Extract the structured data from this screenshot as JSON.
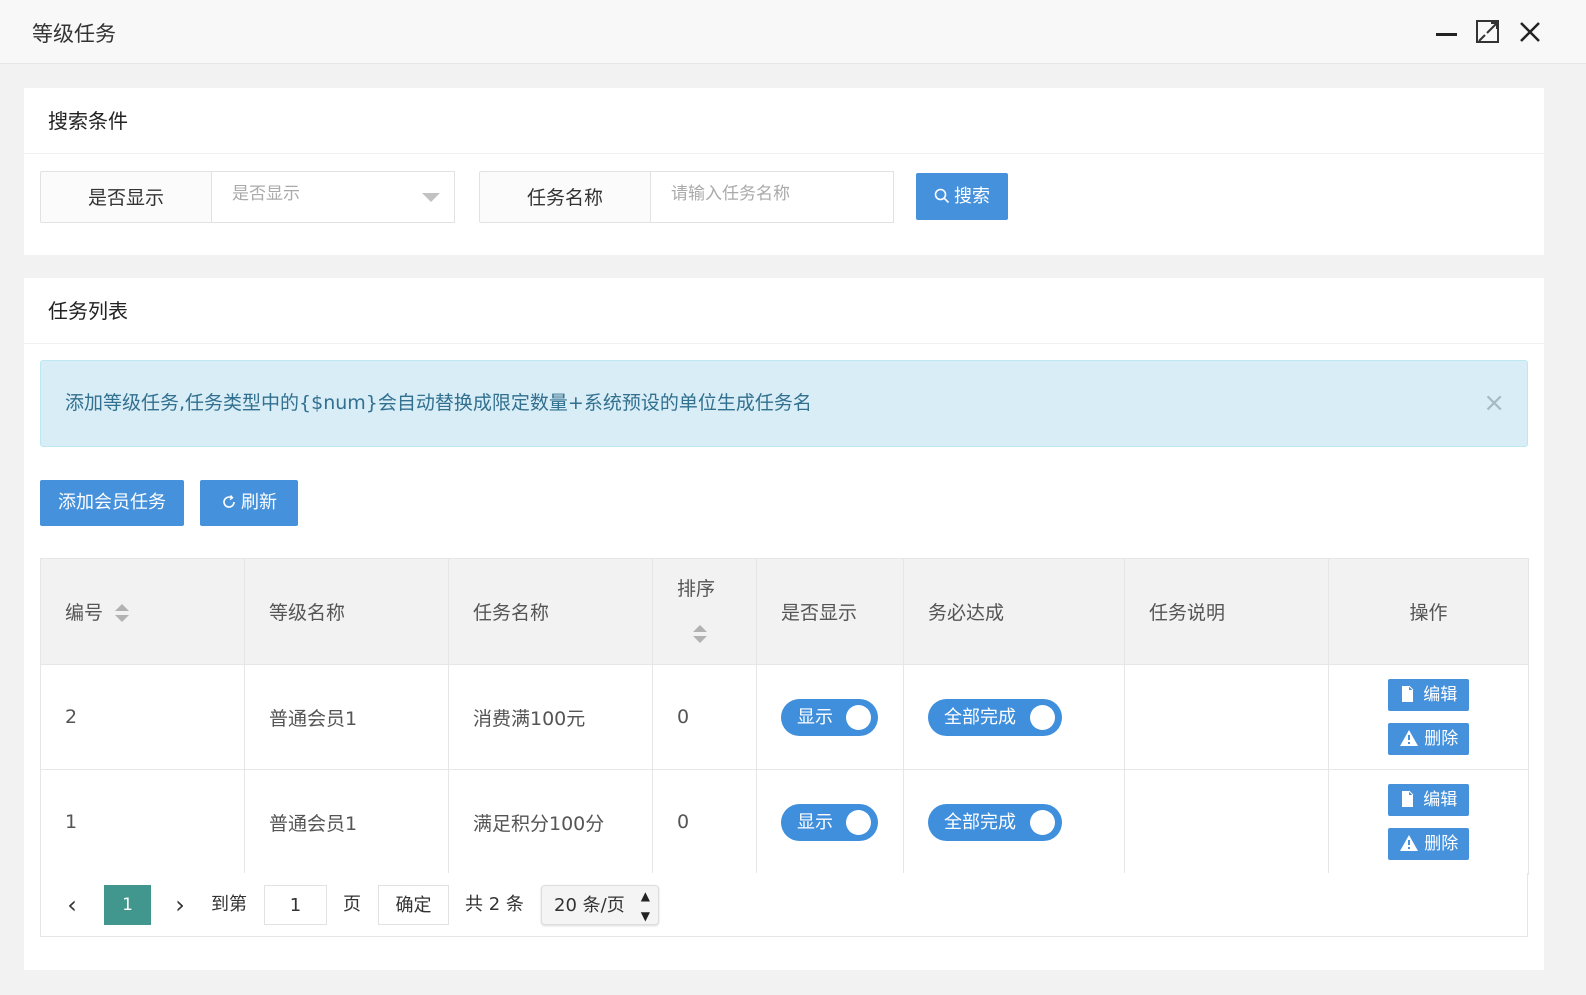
{
  "window": {
    "title": "等级任务"
  },
  "search": {
    "header": "搜索条件",
    "show_label": "是否显示",
    "show_placeholder": "是否显示",
    "name_label": "任务名称",
    "name_placeholder": "请输入任务名称",
    "search_button": "搜索"
  },
  "list": {
    "header": "任务列表",
    "alert_text": "添加等级任务,任务类型中的{$num}会自动替换成限定数量+系统预设的单位生成任务名",
    "alert_close": "×",
    "add_button": "添加会员任务",
    "refresh_button": "刷新",
    "columns": [
      "编号",
      "等级名称",
      "任务名称",
      "排序",
      "是否显示",
      "务必达成",
      "任务说明",
      "操作"
    ],
    "rows": [
      {
        "id": "2",
        "level": "普通会员1",
        "task": "消费满100元",
        "sort": "0",
        "show": "显示",
        "must": "全部完成",
        "desc": "",
        "edit": "编辑",
        "delete": "删除"
      },
      {
        "id": "1",
        "level": "普通会员1",
        "task": "满足积分100分",
        "sort": "0",
        "show": "显示",
        "must": "全部完成",
        "desc": "",
        "edit": "编辑",
        "delete": "删除"
      }
    ]
  },
  "pager": {
    "prev": "‹",
    "current": "1",
    "next": "›",
    "goto_label": "到第",
    "goto_value": "1",
    "page_unit": "页",
    "confirm": "确定",
    "total": "共 2 条",
    "page_size": "20 条/页"
  },
  "colors": {
    "primary": "#4691dc",
    "pager_active": "#41968d",
    "alert_bg": "#d9edf7",
    "alert_text": "#31708f"
  }
}
